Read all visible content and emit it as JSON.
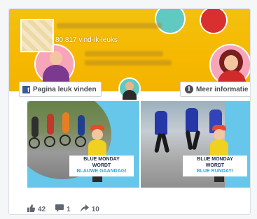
{
  "page": {
    "likes_text": "80.817 vind-ik-leuks"
  },
  "buttons": {
    "like_page": "Pagina leuk vinden",
    "more_info": "Meer informatie"
  },
  "icons": {
    "fb": "facebook-f-icon",
    "info": "info-icon",
    "like": "thumbs-up-icon",
    "comment": "comment-icon",
    "share": "share-arrow-icon"
  },
  "photos": [
    {
      "caption_line1": "BLUE MONDAY",
      "caption_line2": "WORDT",
      "caption_line3": "BLAUWE GAANDAG!"
    },
    {
      "caption_line1": "BLUE MONDAY",
      "caption_line2": "WORDT",
      "caption_line3": "BLUE RUNDAY!"
    }
  ],
  "stats": {
    "likes": "42",
    "comments": "1",
    "shares": "10"
  },
  "colors": {
    "banner": "#f6b800",
    "facebook_blue": "#3b5998",
    "caption_accent": "#27a8e0",
    "photo_bg": "#66c7ea"
  }
}
